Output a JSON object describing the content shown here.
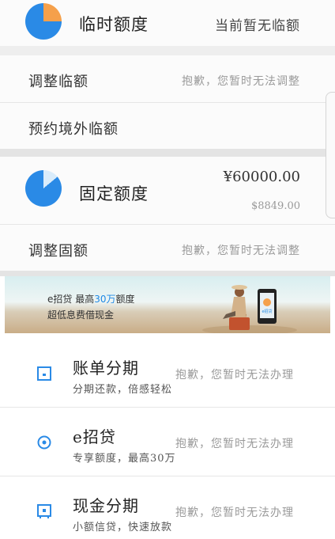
{
  "temp_limit": {
    "icon": "pie-chart-icon",
    "label": "临时额度",
    "status": "当前暂无临额"
  },
  "adjust_temp": {
    "label": "调整临额",
    "status": "抱歉，您暂时无法调整"
  },
  "overseas_temp": {
    "label": "预约境外临额"
  },
  "fixed_limit": {
    "icon": "pie-chart-icon",
    "label": "固定额度",
    "amount": "¥60000.00",
    "available": "$8849.00"
  },
  "adjust_fixed": {
    "label": "调整固额",
    "status": "抱歉，您暂时无法调整"
  },
  "banner": {
    "line1_prefix": "e招贷  最高",
    "line1_highlight": "30万",
    "line1_suffix": "额度",
    "line2": "超低息费借现金",
    "phone_brand": "e招贷",
    "image": "woman-sitting-on-suitcase-with-phone"
  },
  "services": [
    {
      "icon": "bill-installment-icon",
      "title": "账单分期",
      "desc": "分期还款，倍感轻松",
      "status": "抱歉，您暂时无法办理"
    },
    {
      "icon": "e-loan-icon",
      "title": "e招贷",
      "desc": "专享额度，最高30万",
      "status": "抱歉，您暂时无法办理"
    },
    {
      "icon": "cash-installment-icon",
      "title": "现金分期",
      "desc": "小额信贷，快速放款",
      "status": "抱歉，您暂时无法办理"
    }
  ],
  "colors": {
    "temp_pie_orange": "#f5a04b",
    "pie_blue": "#2a8ae6",
    "icon_blue": "#2a8ae6",
    "highlight_blue": "#1e88e5"
  }
}
